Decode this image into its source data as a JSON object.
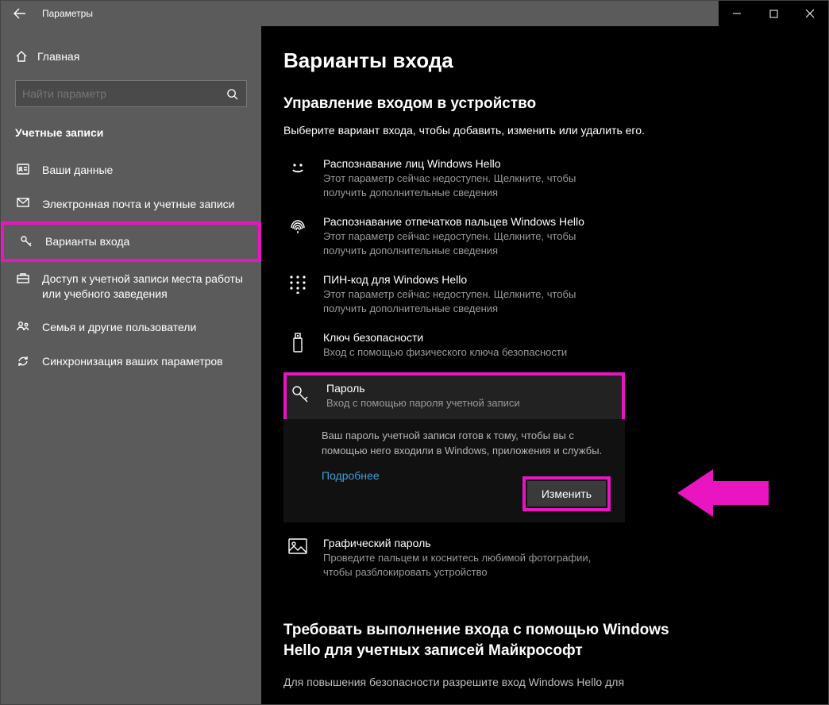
{
  "window": {
    "title": "Параметры"
  },
  "sidebar": {
    "home": "Главная",
    "search_placeholder": "Найти параметр",
    "section": "Учетные записи",
    "items": [
      {
        "label": "Ваши данные"
      },
      {
        "label": "Электронная почта и учетные записи"
      },
      {
        "label": "Варианты входа"
      },
      {
        "label": "Доступ к учетной записи места работы или учебного заведения"
      },
      {
        "label": "Семья и другие пользователи"
      },
      {
        "label": "Синхронизация ваших параметров"
      }
    ]
  },
  "main": {
    "title": "Варианты входа",
    "manage_title": "Управление входом в устройство",
    "manage_desc": "Выберите вариант входа, чтобы добавить, изменить или удалить его.",
    "options": {
      "face": {
        "title": "Распознавание лиц Windows Hello",
        "desc": "Этот параметр сейчас недоступен. Щелкните, чтобы получить дополнительные сведения"
      },
      "finger": {
        "title": "Распознавание отпечатков пальцев Windows Hello",
        "desc": "Этот параметр сейчас недоступен. Щелкните, чтобы получить дополнительные сведения"
      },
      "pin": {
        "title": "ПИН-код для Windows Hello",
        "desc": "Этот параметр сейчас недоступен. Щелкните, чтобы получить дополнительные сведения"
      },
      "key": {
        "title": "Ключ безопасности",
        "desc": "Вход с помощью физического ключа безопасности"
      },
      "pwd": {
        "title": "Пароль",
        "desc": "Вход с помощью пароля учетной записи"
      },
      "pic": {
        "title": "Графический пароль",
        "desc": "Проведите пальцем и коснитесь любимой фотографии, чтобы разблокировать устройство"
      }
    },
    "pwd_panel": {
      "text": "Ваш пароль учетной записи готов к тому, чтобы вы с помощью него входили в Windows, приложения и службы.",
      "link": "Подробнее",
      "button": "Изменить"
    },
    "require_hello_title": "Требовать выполнение входа с помощью Windows Hello для учетных записей Майкрософт",
    "require_hello_desc": "Для повышения безопасности разрешите вход Windows Hello для"
  },
  "highlight_color": "#e815c1"
}
